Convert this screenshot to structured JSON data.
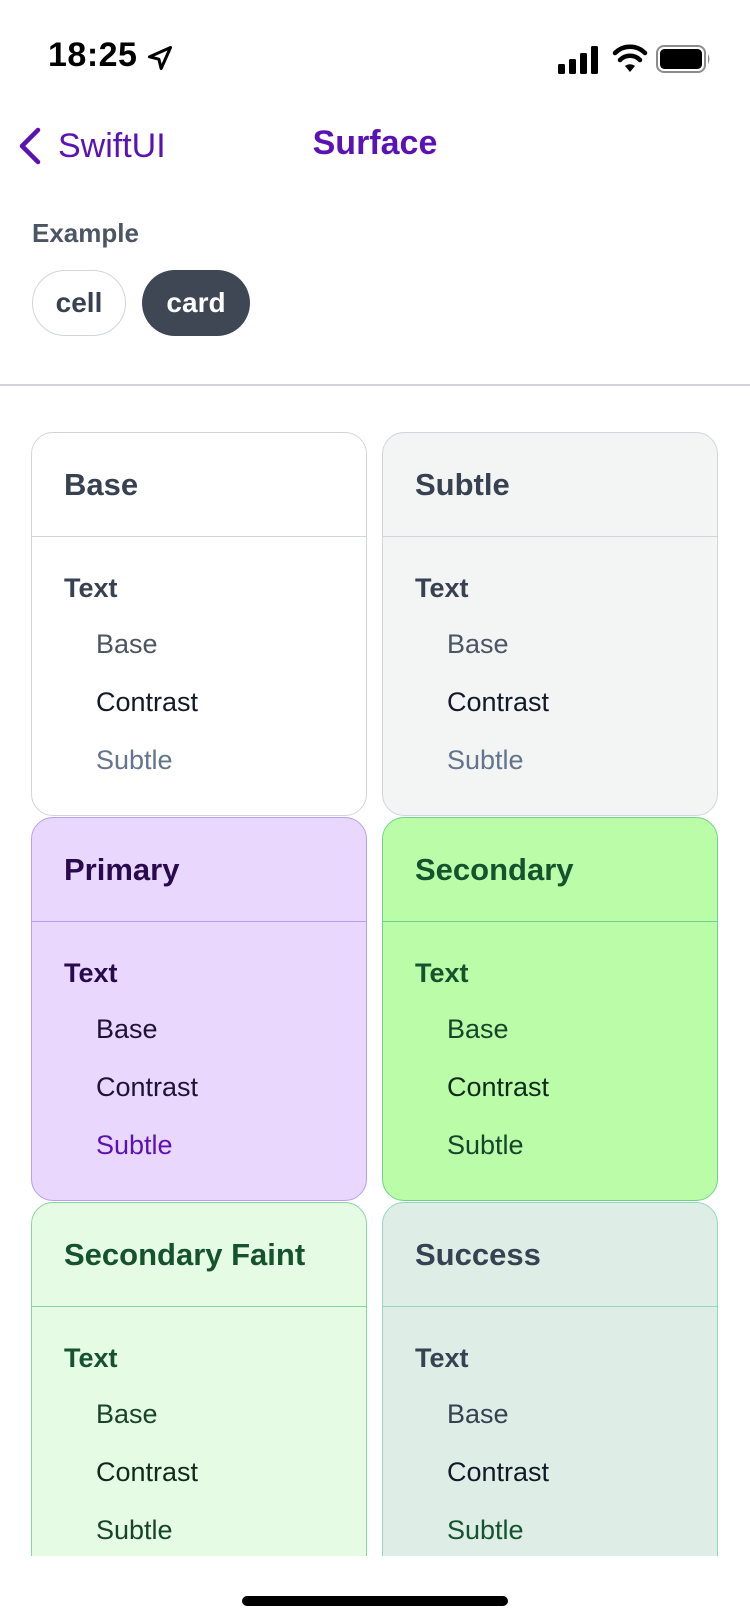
{
  "status": {
    "time": "18:25"
  },
  "nav": {
    "back_label": "SwiftUI",
    "title": "Surface"
  },
  "example": {
    "label": "Example",
    "chips": [
      "cell",
      "card"
    ],
    "selected": "card"
  },
  "cards": [
    {
      "title": "Base",
      "section": "Text",
      "items": [
        "Base",
        "Contrast",
        "Subtle"
      ],
      "colors": {
        "bg": "#ffffff",
        "border": "#d1d5db",
        "title": "#374151",
        "section": "#374151",
        "base": "#4b5563",
        "contrast": "#111827",
        "subtle": "#64748b"
      }
    },
    {
      "title": "Subtle",
      "section": "Text",
      "items": [
        "Base",
        "Contrast",
        "Subtle"
      ],
      "colors": {
        "bg": "#f3f4f4",
        "border": "#d1d5db",
        "title": "#374151",
        "section": "#374151",
        "base": "#4b5563",
        "contrast": "#111827",
        "subtle": "#64748b"
      }
    },
    {
      "title": "Primary",
      "section": "Text",
      "items": [
        "Base",
        "Contrast",
        "Subtle"
      ],
      "colors": {
        "bg": "#e9d7fd",
        "border": "#b89ef0",
        "title": "#2a0a4f",
        "section": "#2a0a4f",
        "base": "#1f1233",
        "contrast": "#1f1233",
        "subtle": "#5b12b5"
      }
    },
    {
      "title": "Secondary",
      "section": "Text",
      "items": [
        "Base",
        "Contrast",
        "Subtle"
      ],
      "colors": {
        "bg": "#bbfca8",
        "border": "#6cd48a",
        "title": "#14532d",
        "section": "#14532d",
        "base": "#17452a",
        "contrast": "#0f2a1a",
        "subtle": "#17452a"
      }
    },
    {
      "title": "Secondary Faint",
      "section": "Text",
      "items": [
        "Base",
        "Contrast",
        "Subtle"
      ],
      "colors": {
        "bg": "#e6fbe4",
        "border": "#86d6a0",
        "title": "#14532d",
        "section": "#14532d",
        "base": "#17452a",
        "contrast": "#0f2a1a",
        "subtle": "#17452a"
      }
    },
    {
      "title": "Success",
      "section": "Text",
      "items": [
        "Base",
        "Contrast",
        "Subtle"
      ],
      "colors": {
        "bg": "#deeee7",
        "border": "#93d6bd",
        "title": "#374151",
        "section": "#374151",
        "base": "#374151",
        "contrast": "#111827",
        "subtle": "#14532d"
      }
    }
  ]
}
